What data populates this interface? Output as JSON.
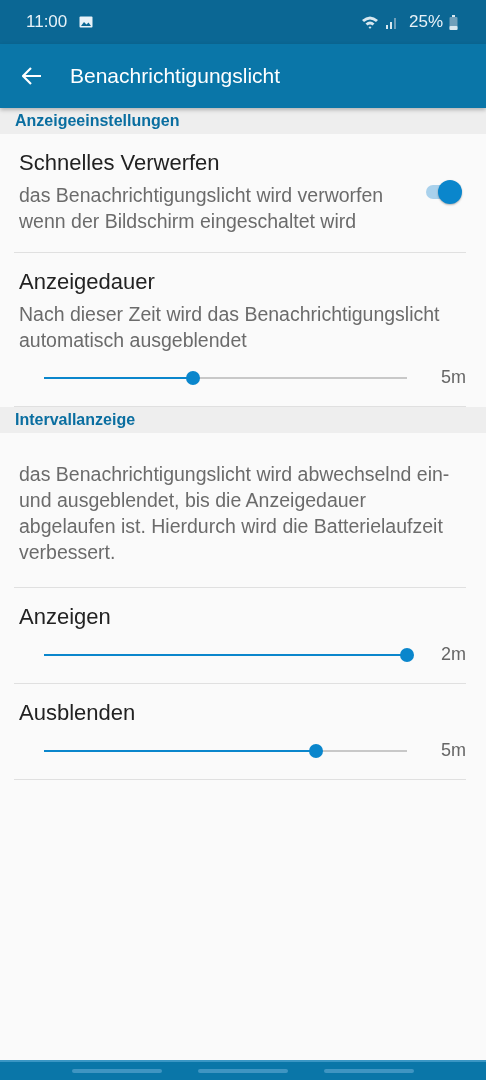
{
  "status_bar": {
    "time": "11:00",
    "battery": "25%"
  },
  "app_bar": {
    "title": "Benachrichtigungslicht"
  },
  "sections": [
    {
      "header": "Anzeigeeinstellungen",
      "items": [
        {
          "kind": "switch",
          "title": "Schnelles Verwerfen",
          "summary": "das Benachrichtigungslicht wird verworfen wenn der Bildschirm eingeschaltet wird",
          "on": true
        },
        {
          "kind": "slider",
          "title": "Anzeigedauer",
          "summary": "Nach dieser Zeit wird das Benachrichtigungslicht automatisch ausgeblendet",
          "level": 0.41,
          "reading": "5m"
        }
      ]
    },
    {
      "header": "Intervallanzeige",
      "items": [
        {
          "kind": "text",
          "summary": "das Benachrichtigungslicht wird abwechselnd ein- und ausgeblendet, bis die Anzeigedauer abgelaufen ist. Hierdurch wird die Batterielaufzeit verbessert."
        },
        {
          "kind": "slider",
          "title": "Anzeigen",
          "level": 1.0,
          "reading": "2m"
        },
        {
          "kind": "slider",
          "title": "Ausblenden",
          "level": 0.75,
          "reading": "5m"
        }
      ]
    }
  ]
}
